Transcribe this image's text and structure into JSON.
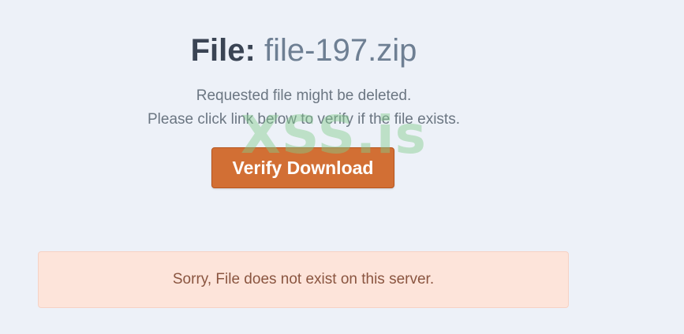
{
  "header": {
    "title_prefix": "File:",
    "file_name": "file-197.zip"
  },
  "messages": {
    "line1": "Requested file might be deleted.",
    "line2": "Please click link below to verify if the file exists."
  },
  "watermark": {
    "text": "XSS.is"
  },
  "actions": {
    "verify_label": "Verify Download"
  },
  "alert": {
    "text": "Sorry, File does not exist on this server."
  },
  "colors": {
    "background": "#edf1f8",
    "button": "#d26f34",
    "alert_bg": "#fde4da",
    "watermark": "#82cd8c"
  }
}
